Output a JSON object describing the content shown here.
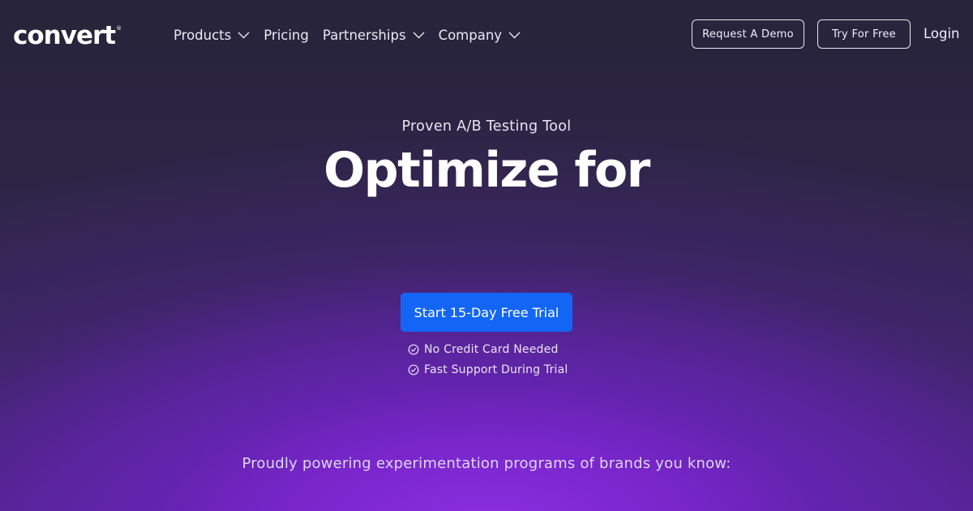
{
  "brand": {
    "logo_text": "convert",
    "registered_mark": "®"
  },
  "nav": {
    "items": [
      {
        "label": "Products",
        "has_dropdown": true,
        "icon": "chevron-down-icon"
      },
      {
        "label": "Pricing",
        "has_dropdown": false
      },
      {
        "label": "Partnerships",
        "has_dropdown": true,
        "icon": "chevron-down-icon"
      },
      {
        "label": "Company",
        "has_dropdown": true,
        "icon": "chevron-down-icon"
      }
    ],
    "request_demo_label": "Request A Demo",
    "try_free_label": "Try For Free",
    "login_label": "Login"
  },
  "hero": {
    "eyebrow": "Proven A/B Testing Tool",
    "headline": "Optimize for",
    "cta_label": "Start 15-Day Free Trial",
    "perks": [
      {
        "label": "No Credit Card Needed",
        "icon": "check-circle-icon"
      },
      {
        "label": "Fast Support During Trial",
        "icon": "check-circle-icon"
      }
    ],
    "tagline": "Proudly powering experimentation programs of brands you know:"
  },
  "colors": {
    "background_dark": "#27243a",
    "glow_purple": "#8a2fe0",
    "cta_blue": "#1366f5",
    "text": "#ffffff"
  }
}
